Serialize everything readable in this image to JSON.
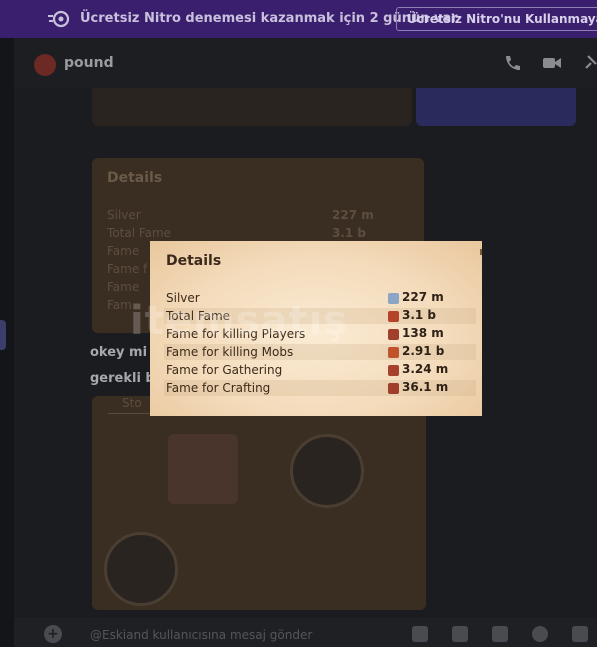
{
  "banner": {
    "text": "Ücretsiz Nitro denemesi kazanmak için 2 günün var",
    "button": "Ücretsiz Nitro'nu Kullanmaya Başla"
  },
  "channel": {
    "name": "pound"
  },
  "chat": {
    "line1": "okey mi",
    "line2": "gerekli b",
    "background_card": {
      "title": "Details",
      "rows": [
        "Silver",
        "Total Fame",
        "Fame",
        "Fame f",
        "Fame",
        "Fam"
      ],
      "values": [
        "227 m",
        "3.1 b"
      ]
    },
    "card2_tab": "Sto"
  },
  "message_bar": {
    "placeholder": "@Eskiand kullanıcısına mesaj gönder"
  },
  "watermark": "itemsatış",
  "details": {
    "title": "Details",
    "rows": [
      {
        "label": "Silver",
        "value": "227 m",
        "icon": "silver-icon",
        "icon_color": "#8aa6c4"
      },
      {
        "label": "Total Fame",
        "value": "3.1 b",
        "icon": "fame-icon",
        "icon_color": "#b5432a"
      },
      {
        "label": "Fame for killing Players",
        "value": "138 m",
        "icon": "pvp-fame-icon",
        "icon_color": "#a0402b"
      },
      {
        "label": "Fame for killing Mobs",
        "value": "2.91 b",
        "icon": "pve-fame-icon",
        "icon_color": "#c0532a"
      },
      {
        "label": "Fame for Gathering",
        "value": "3.24 m",
        "icon": "gathering-fame-icon",
        "icon_color": "#a5412c"
      },
      {
        "label": "Fame for Crafting",
        "value": "36.1 m",
        "icon": "crafting-fame-icon",
        "icon_color": "#9f3e2a"
      }
    ]
  },
  "colors": {
    "banner_bg": "#3a1f6e",
    "app_bg": "#1a1b1f",
    "details_bg": "#f4dcbc"
  }
}
